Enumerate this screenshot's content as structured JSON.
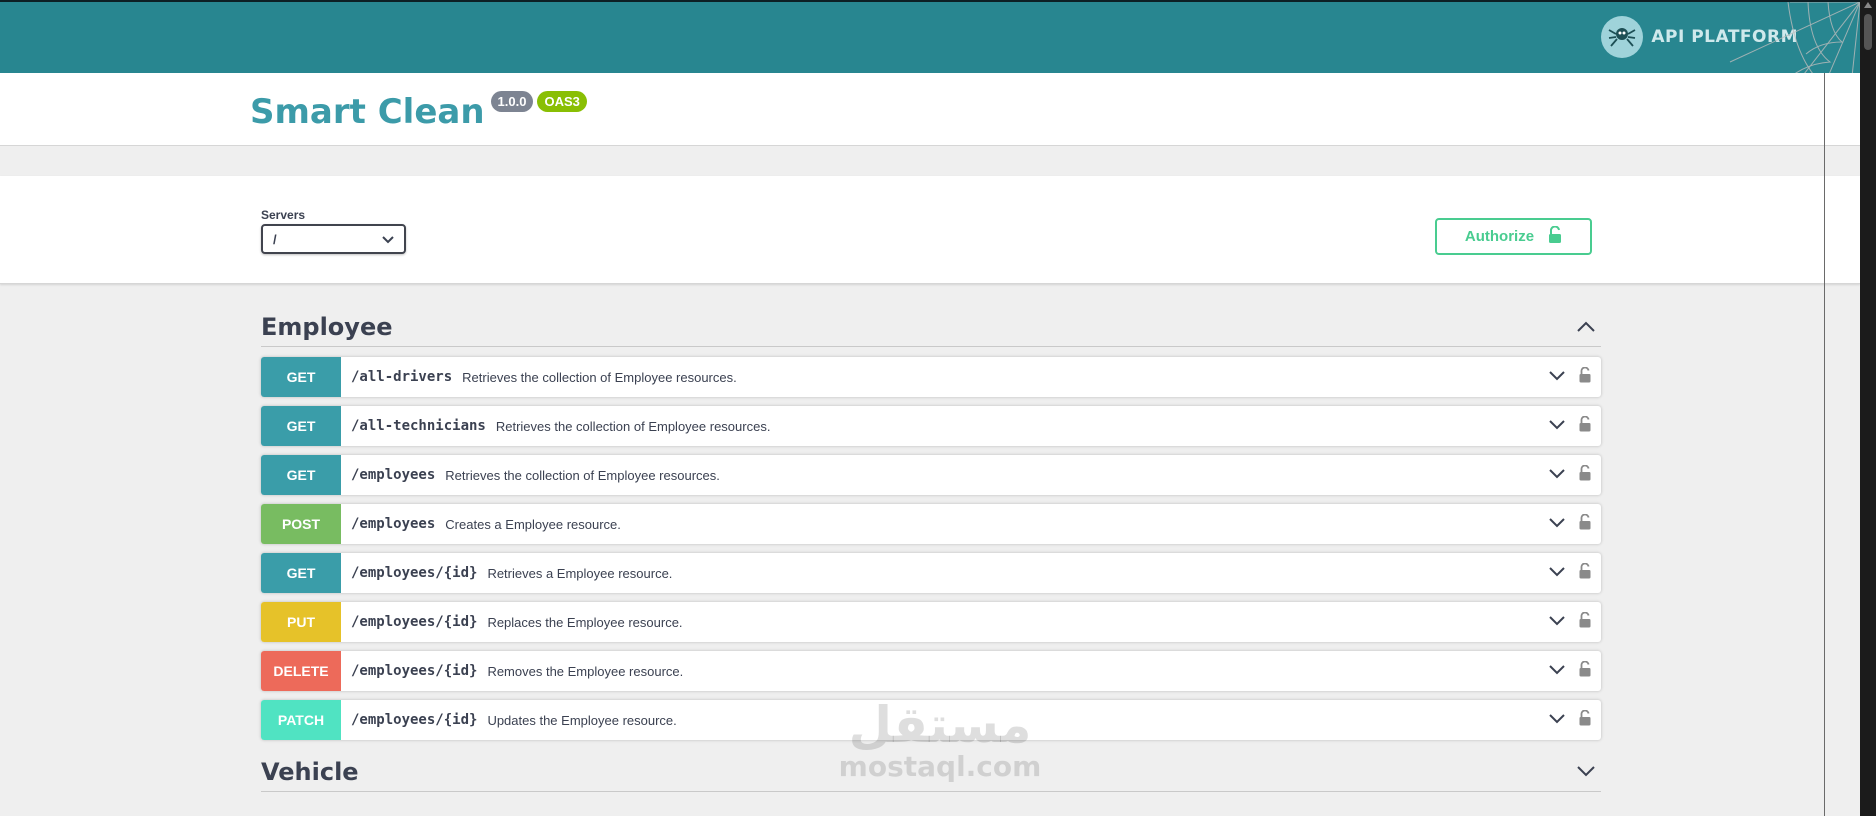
{
  "header": {
    "brand_name": "API PLATFORM",
    "logo_icon": "spider-logo-icon",
    "color": "#288690"
  },
  "info": {
    "title": "Smart Clean",
    "version": "1.0.0",
    "spec": "OAS3"
  },
  "servers": {
    "label": "Servers",
    "selected": "/"
  },
  "authorize": {
    "label": "Authorize",
    "icon": "unlocked-padlock-icon",
    "color": "#49cc90"
  },
  "tags": [
    {
      "name": "Employee",
      "expanded": true,
      "operations": [
        {
          "method": "GET",
          "path": "/all-drivers",
          "summary": "Retrieves the collection of Employee resources.",
          "color": "#3a9da9"
        },
        {
          "method": "GET",
          "path": "/all-technicians",
          "summary": "Retrieves the collection of Employee resources.",
          "color": "#3a9da9"
        },
        {
          "method": "GET",
          "path": "/employees",
          "summary": "Retrieves the collection of Employee resources.",
          "color": "#3a9da9"
        },
        {
          "method": "POST",
          "path": "/employees",
          "summary": "Creates a Employee resource.",
          "color": "#78bc61"
        },
        {
          "method": "GET",
          "path": "/employees/{id}",
          "summary": "Retrieves a Employee resource.",
          "color": "#3a9da9"
        },
        {
          "method": "PUT",
          "path": "/employees/{id}",
          "summary": "Replaces the Employee resource.",
          "color": "#e6c229"
        },
        {
          "method": "DELETE",
          "path": "/employees/{id}",
          "summary": "Removes the Employee resource.",
          "color": "#ed6a5a"
        },
        {
          "method": "PATCH",
          "path": "/employees/{id}",
          "summary": "Updates the Employee resource.",
          "color": "#50e3c2"
        }
      ]
    },
    {
      "name": "Vehicle",
      "expanded": false,
      "operations": []
    }
  ],
  "watermark": {
    "arabic": "مستقل",
    "latin": "mostaql.com"
  }
}
